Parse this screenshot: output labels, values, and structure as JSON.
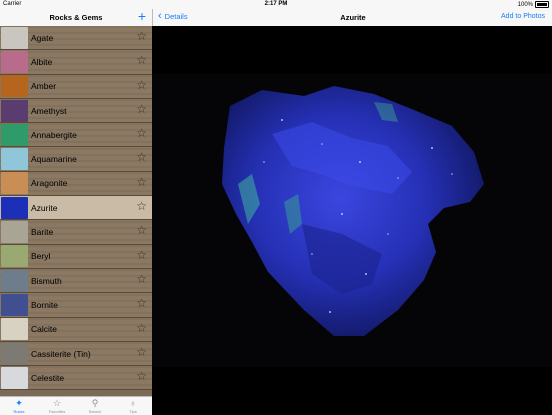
{
  "status_bar": {
    "carrier": "Carrier",
    "time": "2:17 PM",
    "battery": "100%"
  },
  "sidebar": {
    "title": "Rocks & Gems",
    "add_label": "+",
    "items": [
      {
        "label": "Agate",
        "thumb": "#c9c6bf"
      },
      {
        "label": "Albite",
        "thumb": "#b96b8c"
      },
      {
        "label": "Amber",
        "thumb": "#b5651d"
      },
      {
        "label": "Amethyst",
        "thumb": "#5a3d6e"
      },
      {
        "label": "Annabergite",
        "thumb": "#2f9a6a"
      },
      {
        "label": "Aquamarine",
        "thumb": "#8fc6d9"
      },
      {
        "label": "Aragonite",
        "thumb": "#c98d56"
      },
      {
        "label": "Azurite",
        "thumb": "#1c2fb8"
      },
      {
        "label": "Barite",
        "thumb": "#a9a594"
      },
      {
        "label": "Beryl",
        "thumb": "#9aa871"
      },
      {
        "label": "Bismuth",
        "thumb": "#6e7d8c"
      },
      {
        "label": "Bornite",
        "thumb": "#3f4f8f"
      },
      {
        "label": "Calcite",
        "thumb": "#d8d2c2"
      },
      {
        "label": "Cassiterite (Tin)",
        "thumb": "#7d7a73"
      },
      {
        "label": "Celestite",
        "thumb": "#d7d9dc"
      }
    ],
    "selected_index": 7
  },
  "tabbar": {
    "tabs": [
      {
        "label": "Rocks",
        "icon": "rocks-icon",
        "glyph": "✦",
        "active": true
      },
      {
        "label": "Favorites",
        "icon": "star-icon",
        "glyph": "☆",
        "active": false
      },
      {
        "label": "Search",
        "icon": "search-icon",
        "glyph": "⚲",
        "active": false
      },
      {
        "label": "Tips",
        "icon": "lightbulb-icon",
        "glyph": "♁",
        "active": false
      }
    ]
  },
  "detail": {
    "back_label": "Details",
    "title": "Azurite",
    "add_label": "Add to Photos"
  },
  "colors": {
    "accent": "#1a7cf5",
    "wood": "#8b7964",
    "selected_row": "#c9bba6",
    "azurite": "#2a35c8"
  }
}
